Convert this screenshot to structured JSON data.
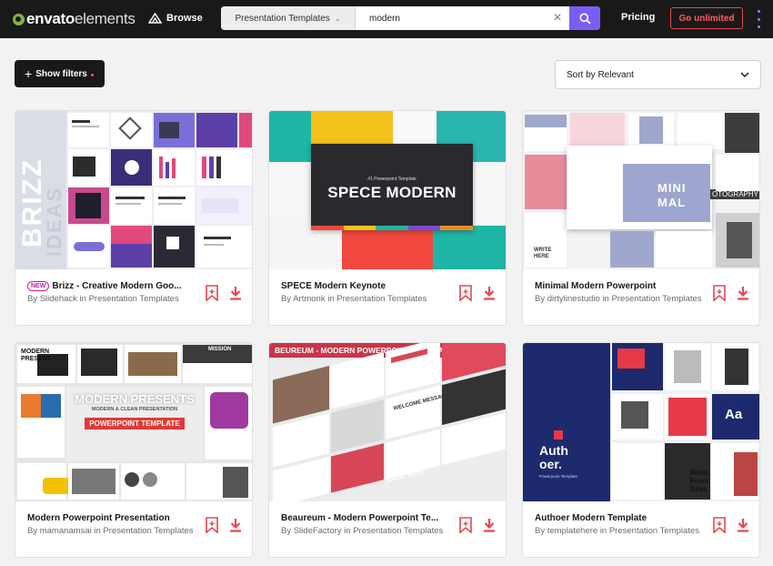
{
  "header": {
    "logo_bold": "envato",
    "logo_light": "elements",
    "browse_label": "Browse",
    "category_label": "Presentation Templates",
    "search_value": "modern",
    "pricing_label": "Pricing",
    "unlimited_label": "Go unlimited",
    "accent_color": "#7b5cf5",
    "cta_color": "#ff5a5f"
  },
  "filters": {
    "show_filters_label": "Show filters",
    "sort_label": "Sort by Relevant"
  },
  "items": [
    {
      "badge": "NEW",
      "title": "Brizz - Creative Modern Goo...",
      "byline": "By Slidehack in Presentation Templates",
      "thumb_text": [
        "BRIZZ",
        "IDEAS"
      ]
    },
    {
      "title": "SPECE Modern Keynote",
      "byline": "By Artmonk in Presentation Templates",
      "thumb_text": [
        "#1 Powerpoint Template",
        "SPECE MODERN"
      ]
    },
    {
      "title": "Minimal Modern Powerpoint",
      "byline": "By dirtylinestudio in Presentation Templates",
      "thumb_text": [
        "MINI",
        "MAL",
        "OTOGRAPHY",
        "WRITE HERE"
      ]
    },
    {
      "title": "Modern Powerpoint Presentation",
      "byline": "By mamanamsai in Presentation Templates",
      "thumb_text": [
        "MODERN PRESENT",
        "MODERN PRESENTS",
        "MODERN & CLEAN PRESENTATION",
        "POWERPOINT TEMPLATE",
        "MISSION"
      ]
    },
    {
      "title": "Beaureum - Modern Powerpoint Te...",
      "byline": "By SlideFactory in Presentation Templates",
      "thumb_text": [
        "BEUREUM - MODERN POWERPOINT TEMPLATE",
        "WELCOME MESSAGE",
        "SOCIAL MEDIA"
      ]
    },
    {
      "title": "Authoer Modern Template",
      "byline": "By templatehere in Presentation Templates",
      "thumb_text": [
        "Auth",
        "oer.",
        "Powerpoint Template",
        "Aa",
        "Hello, From Scot,"
      ]
    }
  ]
}
